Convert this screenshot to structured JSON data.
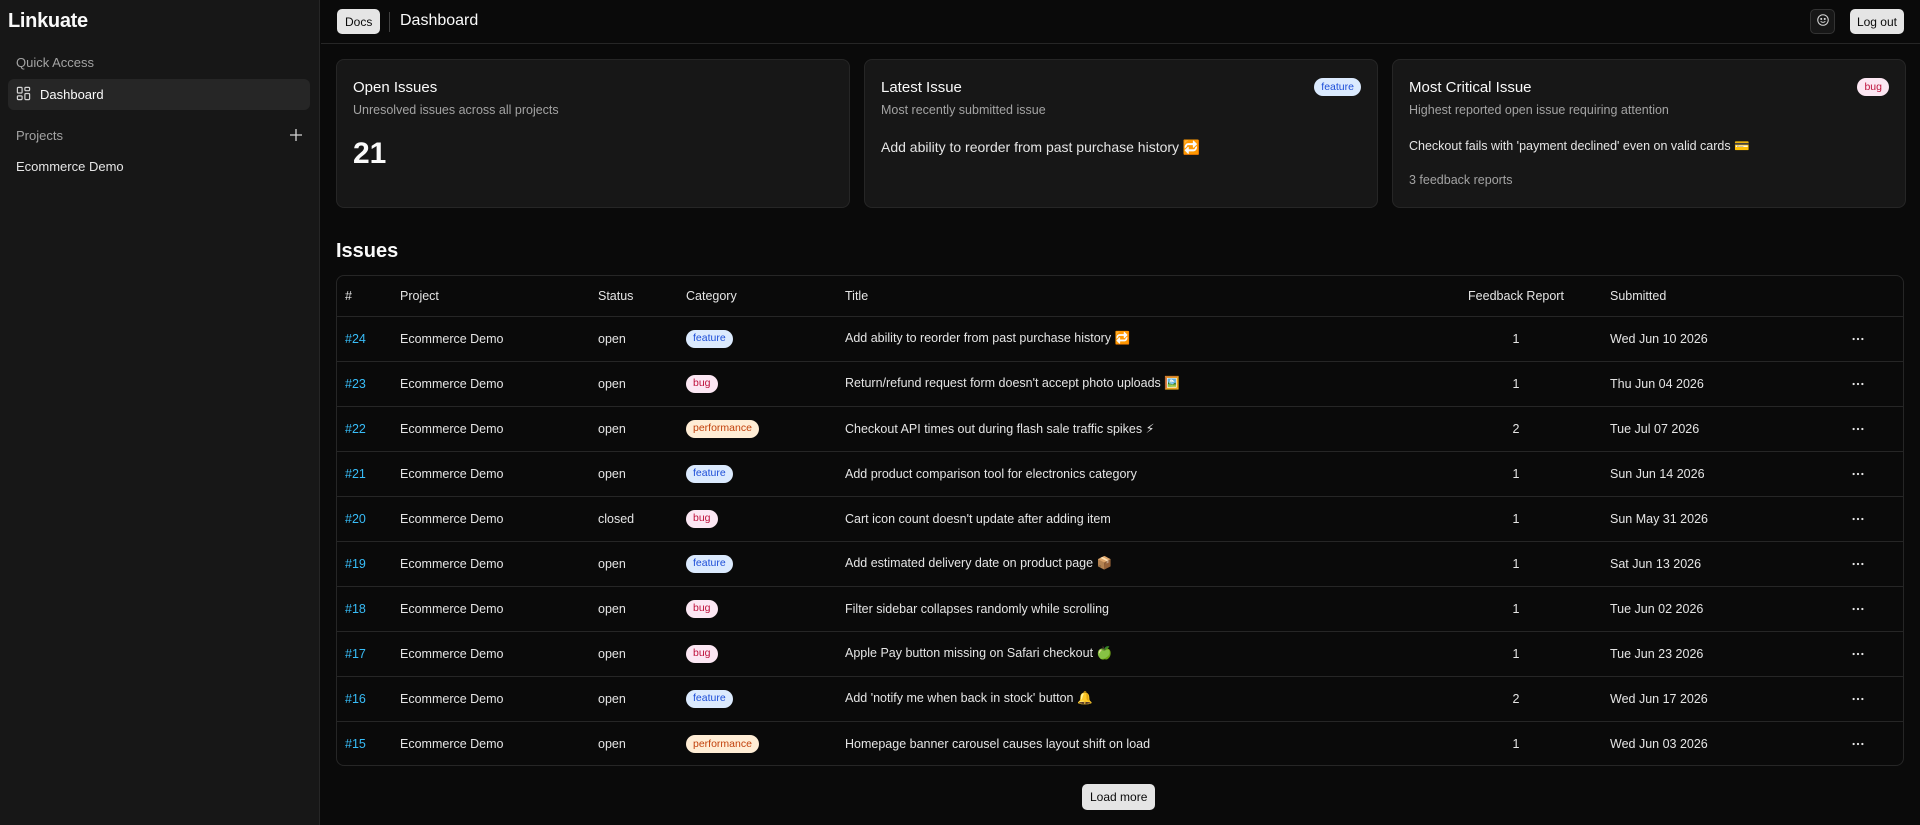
{
  "app": {
    "name": "Linkuate"
  },
  "sidebar": {
    "quick_access_label": "Quick Access",
    "items": [
      {
        "label": "Dashboard",
        "icon": "dashboard-icon",
        "active": true
      }
    ],
    "projects_label": "Projects",
    "projects": [
      {
        "label": "Ecommerce Demo"
      }
    ]
  },
  "header": {
    "docs_label": "Docs",
    "title": "Dashboard",
    "theme_icon": "smiley-icon",
    "logout_label": "Log out"
  },
  "cards": {
    "open_issues": {
      "title": "Open Issues",
      "description": "Unresolved issues across all projects",
      "value": "21"
    },
    "latest_issue": {
      "title": "Latest Issue",
      "description": "Most recently submitted issue",
      "badge": "feature",
      "text": "Add ability to reorder from past purchase history 🔁"
    },
    "critical_issue": {
      "title": "Most Critical Issue",
      "description": "Highest reported open issue requiring attention",
      "badge": "bug",
      "text": "Checkout fails with 'payment declined' even on valid cards 💳",
      "sub": "3 feedback reports"
    }
  },
  "issues": {
    "heading": "Issues",
    "columns": {
      "num": "#",
      "project": "Project",
      "status": "Status",
      "category": "Category",
      "title": "Title",
      "feedback": "Feedback Report",
      "submitted": "Submitted"
    },
    "rows": [
      {
        "id": "#24",
        "project": "Ecommerce Demo",
        "status": "open",
        "category": "feature",
        "title": "Add ability to reorder from past purchase history 🔁",
        "feedback": "1",
        "submitted": "Wed Jun 10 2026"
      },
      {
        "id": "#23",
        "project": "Ecommerce Demo",
        "status": "open",
        "category": "bug",
        "title": "Return/refund request form doesn't accept photo uploads 🖼️",
        "feedback": "1",
        "submitted": "Thu Jun 04 2026"
      },
      {
        "id": "#22",
        "project": "Ecommerce Demo",
        "status": "open",
        "category": "performance",
        "title": "Checkout API times out during flash sale traffic spikes ⚡",
        "feedback": "2",
        "submitted": "Tue Jul 07 2026"
      },
      {
        "id": "#21",
        "project": "Ecommerce Demo",
        "status": "open",
        "category": "feature",
        "title": "Add product comparison tool for electronics category",
        "feedback": "1",
        "submitted": "Sun Jun 14 2026"
      },
      {
        "id": "#20",
        "project": "Ecommerce Demo",
        "status": "closed",
        "category": "bug",
        "title": "Cart icon count doesn't update after adding item",
        "feedback": "1",
        "submitted": "Sun May 31 2026"
      },
      {
        "id": "#19",
        "project": "Ecommerce Demo",
        "status": "open",
        "category": "feature",
        "title": "Add estimated delivery date on product page 📦",
        "feedback": "1",
        "submitted": "Sat Jun 13 2026"
      },
      {
        "id": "#18",
        "project": "Ecommerce Demo",
        "status": "open",
        "category": "bug",
        "title": "Filter sidebar collapses randomly while scrolling",
        "feedback": "1",
        "submitted": "Tue Jun 02 2026"
      },
      {
        "id": "#17",
        "project": "Ecommerce Demo",
        "status": "open",
        "category": "bug",
        "title": "Apple Pay button missing on Safari checkout 🍏",
        "feedback": "1",
        "submitted": "Tue Jun 23 2026"
      },
      {
        "id": "#16",
        "project": "Ecommerce Demo",
        "status": "open",
        "category": "feature",
        "title": "Add 'notify me when back in stock' button 🔔",
        "feedback": "2",
        "submitted": "Wed Jun 17 2026"
      },
      {
        "id": "#15",
        "project": "Ecommerce Demo",
        "status": "open",
        "category": "performance",
        "title": "Homepage banner carousel causes layout shift on load",
        "feedback": "1",
        "submitted": "Wed Jun 03 2026"
      }
    ],
    "row_action_icon": "more-horizontal-icon",
    "load_more_label": "Load more"
  }
}
